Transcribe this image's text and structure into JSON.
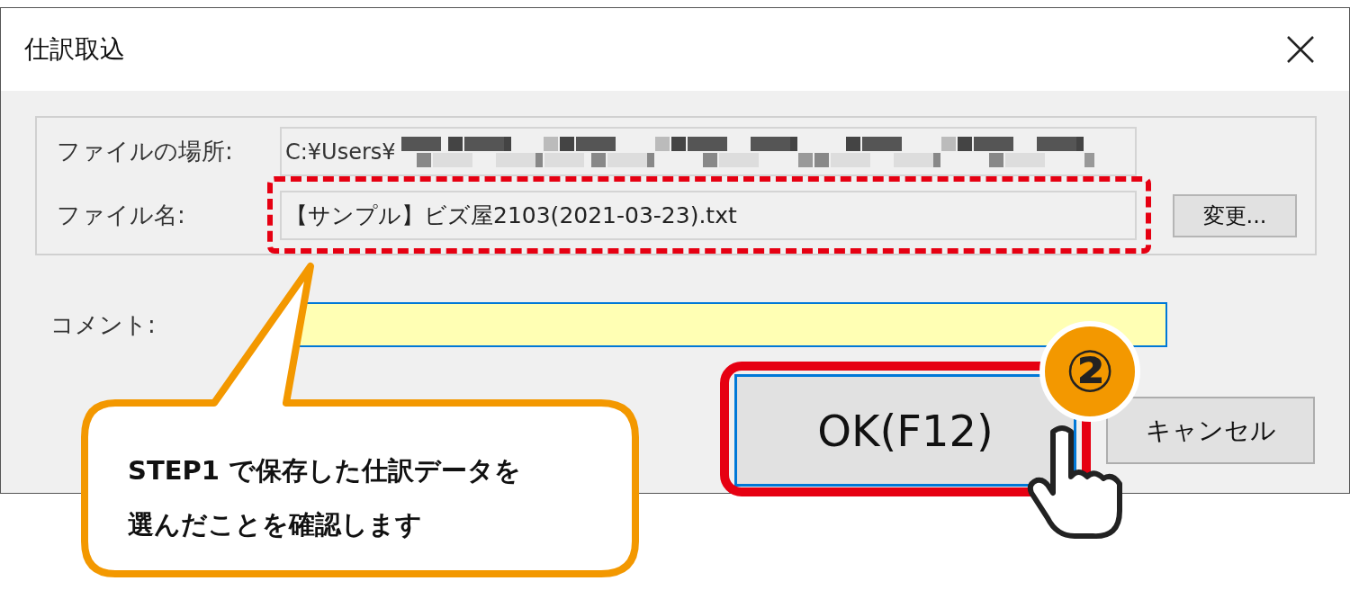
{
  "window": {
    "title": "仕訳取込"
  },
  "file_location": {
    "label": "ファイルの場所:",
    "value": "C:¥Users¥"
  },
  "file_name": {
    "label": "ファイル名:",
    "value": "【サンプル】ビズ屋2103(2021-03-23).txt",
    "highlighted": true
  },
  "change_button": "変更...",
  "comment": {
    "label": "コメント:",
    "focused": true
  },
  "ok_button": {
    "label": "OK(F12)",
    "highlighted": true
  },
  "cancel_button": "キャンセル",
  "annotations": {
    "step_badge": "②",
    "callout": [
      "STEP1 で保存した仕訳データを",
      "選んだことを確認します"
    ]
  }
}
